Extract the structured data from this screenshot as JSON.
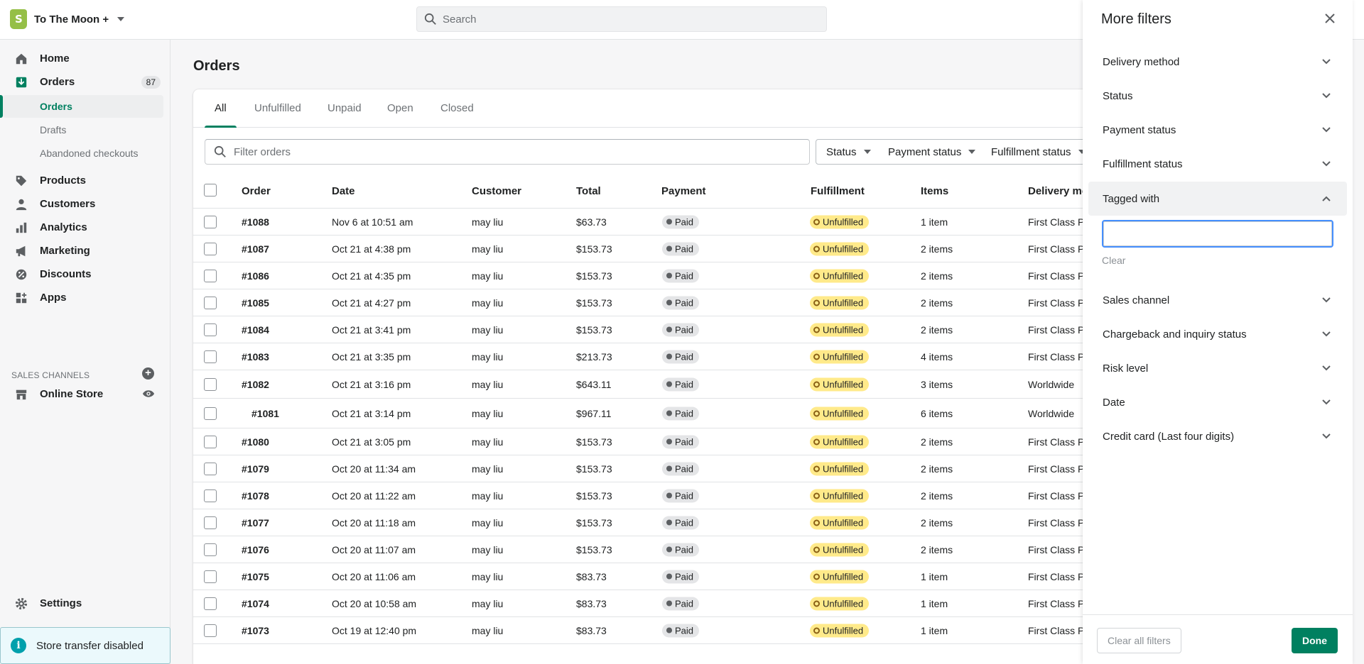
{
  "topbar": {
    "store_name": "To The Moon +",
    "search_placeholder": "Search"
  },
  "sidebar": {
    "home": "Home",
    "orders": "Orders",
    "orders_badge": "87",
    "orders_sub": [
      "Orders",
      "Drafts",
      "Abandoned checkouts"
    ],
    "products": "Products",
    "customers": "Customers",
    "analytics": "Analytics",
    "marketing": "Marketing",
    "discounts": "Discounts",
    "apps": "Apps",
    "sales_channels_label": "SALES CHANNELS",
    "online_store": "Online Store",
    "settings": "Settings",
    "store_transfer": "Store transfer disabled"
  },
  "main": {
    "title": "Orders",
    "tabs": [
      "All",
      "Unfulfilled",
      "Unpaid",
      "Open",
      "Closed"
    ],
    "filter_placeholder": "Filter orders",
    "filter_buttons": [
      "Status",
      "Payment status",
      "Fulfillment status"
    ],
    "columns": [
      "Order",
      "Date",
      "Customer",
      "Total",
      "Payment",
      "Fulfillment",
      "Items",
      "Delivery me"
    ],
    "rows": [
      {
        "order": "#1088",
        "date": "Nov 6 at 10:51 am",
        "customer": "may liu",
        "total": "$63.73",
        "payment": "Paid",
        "fulfillment": "Unfulfilled",
        "items": "1 item",
        "delivery": "First Class Pa"
      },
      {
        "order": "#1087",
        "date": "Oct 21 at 4:38 pm",
        "customer": "may liu",
        "total": "$153.73",
        "payment": "Paid",
        "fulfillment": "Unfulfilled",
        "items": "2 items",
        "delivery": "First Class Pa"
      },
      {
        "order": "#1086",
        "date": "Oct 21 at 4:35 pm",
        "customer": "may liu",
        "total": "$153.73",
        "payment": "Paid",
        "fulfillment": "Unfulfilled",
        "items": "2 items",
        "delivery": "First Class Pa"
      },
      {
        "order": "#1085",
        "date": "Oct 21 at 4:27 pm",
        "customer": "may liu",
        "total": "$153.73",
        "payment": "Paid",
        "fulfillment": "Unfulfilled",
        "items": "2 items",
        "delivery": "First Class Pa"
      },
      {
        "order": "#1084",
        "date": "Oct 21 at 3:41 pm",
        "customer": "may liu",
        "total": "$153.73",
        "payment": "Paid",
        "fulfillment": "Unfulfilled",
        "items": "2 items",
        "delivery": "First Class Pa"
      },
      {
        "order": "#1083",
        "date": "Oct 21 at 3:35 pm",
        "customer": "may liu",
        "total": "$213.73",
        "payment": "Paid",
        "fulfillment": "Unfulfilled",
        "items": "4 items",
        "delivery": "First Class Pa"
      },
      {
        "order": "#1082",
        "date": "Oct 21 at 3:16 pm",
        "customer": "may liu",
        "total": "$643.11",
        "payment": "Paid",
        "fulfillment": "Unfulfilled",
        "items": "3 items",
        "delivery": "Worldwide"
      },
      {
        "order": "#1081",
        "date": "Oct 21 at 3:14 pm",
        "customer": "may liu",
        "total": "$967.11",
        "payment": "Paid",
        "fulfillment": "Unfulfilled",
        "items": "6 items",
        "delivery": "Worldwide"
      },
      {
        "order": "#1080",
        "date": "Oct 21 at 3:05 pm",
        "customer": "may liu",
        "total": "$153.73",
        "payment": "Paid",
        "fulfillment": "Unfulfilled",
        "items": "2 items",
        "delivery": "First Class Pa"
      },
      {
        "order": "#1079",
        "date": "Oct 20 at 11:34 am",
        "customer": "may liu",
        "total": "$153.73",
        "payment": "Paid",
        "fulfillment": "Unfulfilled",
        "items": "2 items",
        "delivery": "First Class Pa"
      },
      {
        "order": "#1078",
        "date": "Oct 20 at 11:22 am",
        "customer": "may liu",
        "total": "$153.73",
        "payment": "Paid",
        "fulfillment": "Unfulfilled",
        "items": "2 items",
        "delivery": "First Class Pa"
      },
      {
        "order": "#1077",
        "date": "Oct 20 at 11:18 am",
        "customer": "may liu",
        "total": "$153.73",
        "payment": "Paid",
        "fulfillment": "Unfulfilled",
        "items": "2 items",
        "delivery": "First Class Pa"
      },
      {
        "order": "#1076",
        "date": "Oct 20 at 11:07 am",
        "customer": "may liu",
        "total": "$153.73",
        "payment": "Paid",
        "fulfillment": "Unfulfilled",
        "items": "2 items",
        "delivery": "First Class Pa"
      },
      {
        "order": "#1075",
        "date": "Oct 20 at 11:06 am",
        "customer": "may liu",
        "total": "$83.73",
        "payment": "Paid",
        "fulfillment": "Unfulfilled",
        "items": "1 item",
        "delivery": "First Class Pa"
      },
      {
        "order": "#1074",
        "date": "Oct 20 at 10:58 am",
        "customer": "may liu",
        "total": "$83.73",
        "payment": "Paid",
        "fulfillment": "Unfulfilled",
        "items": "1 item",
        "delivery": "First Class Pa"
      },
      {
        "order": "#1073",
        "date": "Oct 19 at 12:40 pm",
        "customer": "may liu",
        "total": "$83.73",
        "payment": "Paid",
        "fulfillment": "Unfulfilled",
        "items": "1 item",
        "delivery": "First Class Pa"
      }
    ]
  },
  "drawer": {
    "title": "More filters",
    "sections": [
      "Delivery method",
      "Status",
      "Payment status",
      "Fulfillment status",
      "Tagged with",
      "Sales channel",
      "Chargeback and inquiry status",
      "Risk level",
      "Date",
      "Credit card (Last four digits)"
    ],
    "tag_input_value": "",
    "clear": "Clear",
    "clear_all": "Clear all filters",
    "done": "Done"
  },
  "colors": {
    "accent": "#008060",
    "paid_pill": "#e4e5e7",
    "unfulfilled_pill": "#ffea8a",
    "focus": "#458fff"
  }
}
